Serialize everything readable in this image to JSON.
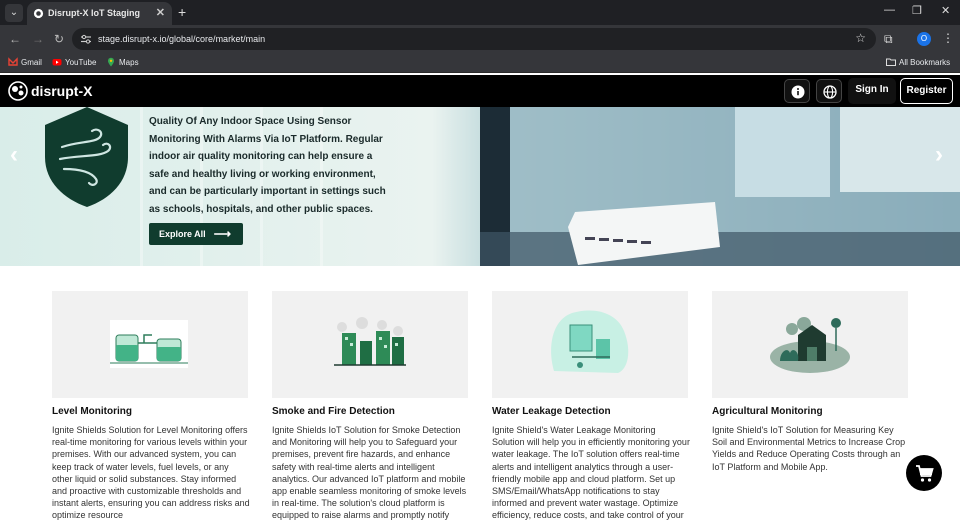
{
  "browser": {
    "tab_title": "Disrupt-X IoT Staging",
    "url": "stage.disrupt-x.io/global/core/market/main",
    "profile_initial": "O",
    "bookmarks": [
      {
        "label": "Gmail",
        "icon": "gmail-icon"
      },
      {
        "label": "YouTube",
        "icon": "youtube-icon"
      },
      {
        "label": "Maps",
        "icon": "maps-icon"
      }
    ],
    "all_bookmarks": "All Bookmarks"
  },
  "header": {
    "logo_text": "disrupt-X",
    "sign_in": "Sign In",
    "register": "Register"
  },
  "hero": {
    "text": "Quality Of Any Indoor Space Using Sensor Monitoring With Alarms Via IoT Platform. Regular indoor air quality monitoring can help ensure a safe and healthy living or working environment, and can be particularly important in settings such as schools, hospitals, and other public spaces.",
    "cta": "Explore All"
  },
  "cards": [
    {
      "title": "Level Monitoring",
      "description": "Ignite Shields Solution for Level Monitoring offers real-time monitoring for various levels within your premises. With our advanced system, you can keep track of water levels, fuel levels, or any other liquid or solid substances. Stay informed and proactive with customizable thresholds and instant alerts, ensuring you can address risks and optimize resource"
    },
    {
      "title": "Smoke and Fire Detection",
      "description": "Ignite Shields IoT Solution for Smoke Detection and Monitoring will help you to Safeguard your premises, prevent fire hazards, and enhance safety with real-time alerts and intelligent analytics. Our advanced IoT platform and mobile app enable seamless monitoring of smoke levels in real-time. The solution's cloud platform is equipped to raise alarms and promptly notify"
    },
    {
      "title": "Water Leakage Detection",
      "description": "Ignite Shield's Water Leakage Monitoring Solution will help you in efficiently monitoring your water leakage. The IoT solution offers real-time alerts and intelligent analytics through a user-friendly mobile app and cloud platform. Set up SMS/Email/WhatsApp notifications to stay informed and prevent water wastage. Optimize efficiency, reduce costs, and take control of your"
    },
    {
      "title": "Agricultural Monitoring",
      "description": "Ignite Shield's IoT Solution for Measuring Key Soil and Environmental Metrics to Increase Crop Yields and Reduce Operating Costs through an IoT Platform and Mobile App."
    }
  ],
  "colors": {
    "accent": "#103c2e",
    "header_bg": "#000000",
    "chrome": "#35363a"
  }
}
